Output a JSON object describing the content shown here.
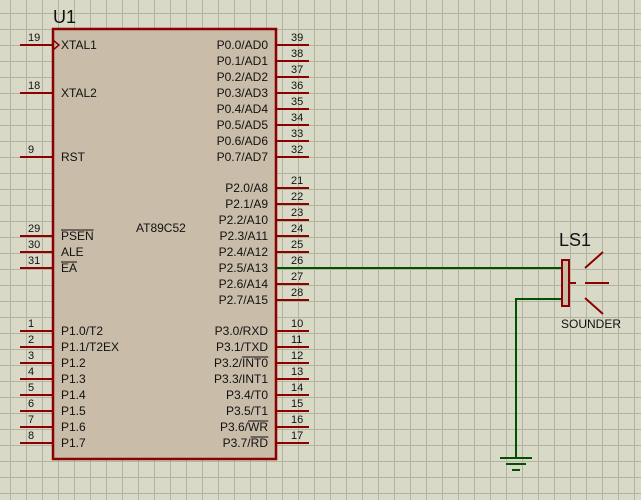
{
  "colors": {
    "pin": "#8b0000",
    "body_fill": "#c9bca9",
    "body_stroke": "#8b0000",
    "wire": "#005200",
    "text": "#111111",
    "grid": "#b3b3a0",
    "background": "#d9d9c8"
  },
  "chip": {
    "ref": "U1",
    "part": "AT89C52",
    "left_pins": [
      {
        "num": "19",
        "name": "XTAL1",
        "clock": true
      },
      {
        "num": "18",
        "name": "XTAL2"
      },
      {
        "num": "9",
        "name": "RST"
      },
      {
        "num": "29",
        "name": "PSEN",
        "overbar": true
      },
      {
        "num": "30",
        "name": "ALE"
      },
      {
        "num": "31",
        "name": "EA",
        "overbar": true
      },
      {
        "num": "1",
        "name": "P1.0/T2"
      },
      {
        "num": "2",
        "name": "P1.1/T2EX"
      },
      {
        "num": "3",
        "name": "P1.2"
      },
      {
        "num": "4",
        "name": "P1.3"
      },
      {
        "num": "5",
        "name": "P1.4"
      },
      {
        "num": "6",
        "name": "P1.5"
      },
      {
        "num": "7",
        "name": "P1.6"
      },
      {
        "num": "8",
        "name": "P1.7"
      }
    ],
    "right_pins": [
      {
        "num": "39",
        "name": "P0.0/AD0"
      },
      {
        "num": "38",
        "name": "P0.1/AD1"
      },
      {
        "num": "37",
        "name": "P0.2/AD2"
      },
      {
        "num": "36",
        "name": "P0.3/AD3"
      },
      {
        "num": "35",
        "name": "P0.4/AD4"
      },
      {
        "num": "34",
        "name": "P0.5/AD5"
      },
      {
        "num": "33",
        "name": "P0.6/AD6"
      },
      {
        "num": "32",
        "name": "P0.7/AD7"
      },
      {
        "num": "21",
        "name": "P2.0/A8"
      },
      {
        "num": "22",
        "name": "P2.1/A9"
      },
      {
        "num": "23",
        "name": "P2.2/A10"
      },
      {
        "num": "24",
        "name": "P2.3/A11"
      },
      {
        "num": "25",
        "name": "P2.4/A12"
      },
      {
        "num": "26",
        "name": "P2.5/A13",
        "wired": true
      },
      {
        "num": "27",
        "name": "P2.6/A14"
      },
      {
        "num": "28",
        "name": "P2.7/A15"
      },
      {
        "num": "10",
        "name": "P3.0/RXD"
      },
      {
        "num": "11",
        "name": "P3.1/TXD"
      },
      {
        "num": "12",
        "name": "P3.2/",
        "suffix_overbar": "INT0"
      },
      {
        "num": "13",
        "name": "P3.3/INT1"
      },
      {
        "num": "14",
        "name": "P3.4/T0"
      },
      {
        "num": "15",
        "name": "P3.5/T1"
      },
      {
        "num": "16",
        "name": "P3.6/",
        "suffix_overbar": "WR"
      },
      {
        "num": "17",
        "name": "P3.7/",
        "suffix_overbar": "RD"
      }
    ]
  },
  "sounder": {
    "ref": "LS1",
    "value": "SOUNDER"
  }
}
